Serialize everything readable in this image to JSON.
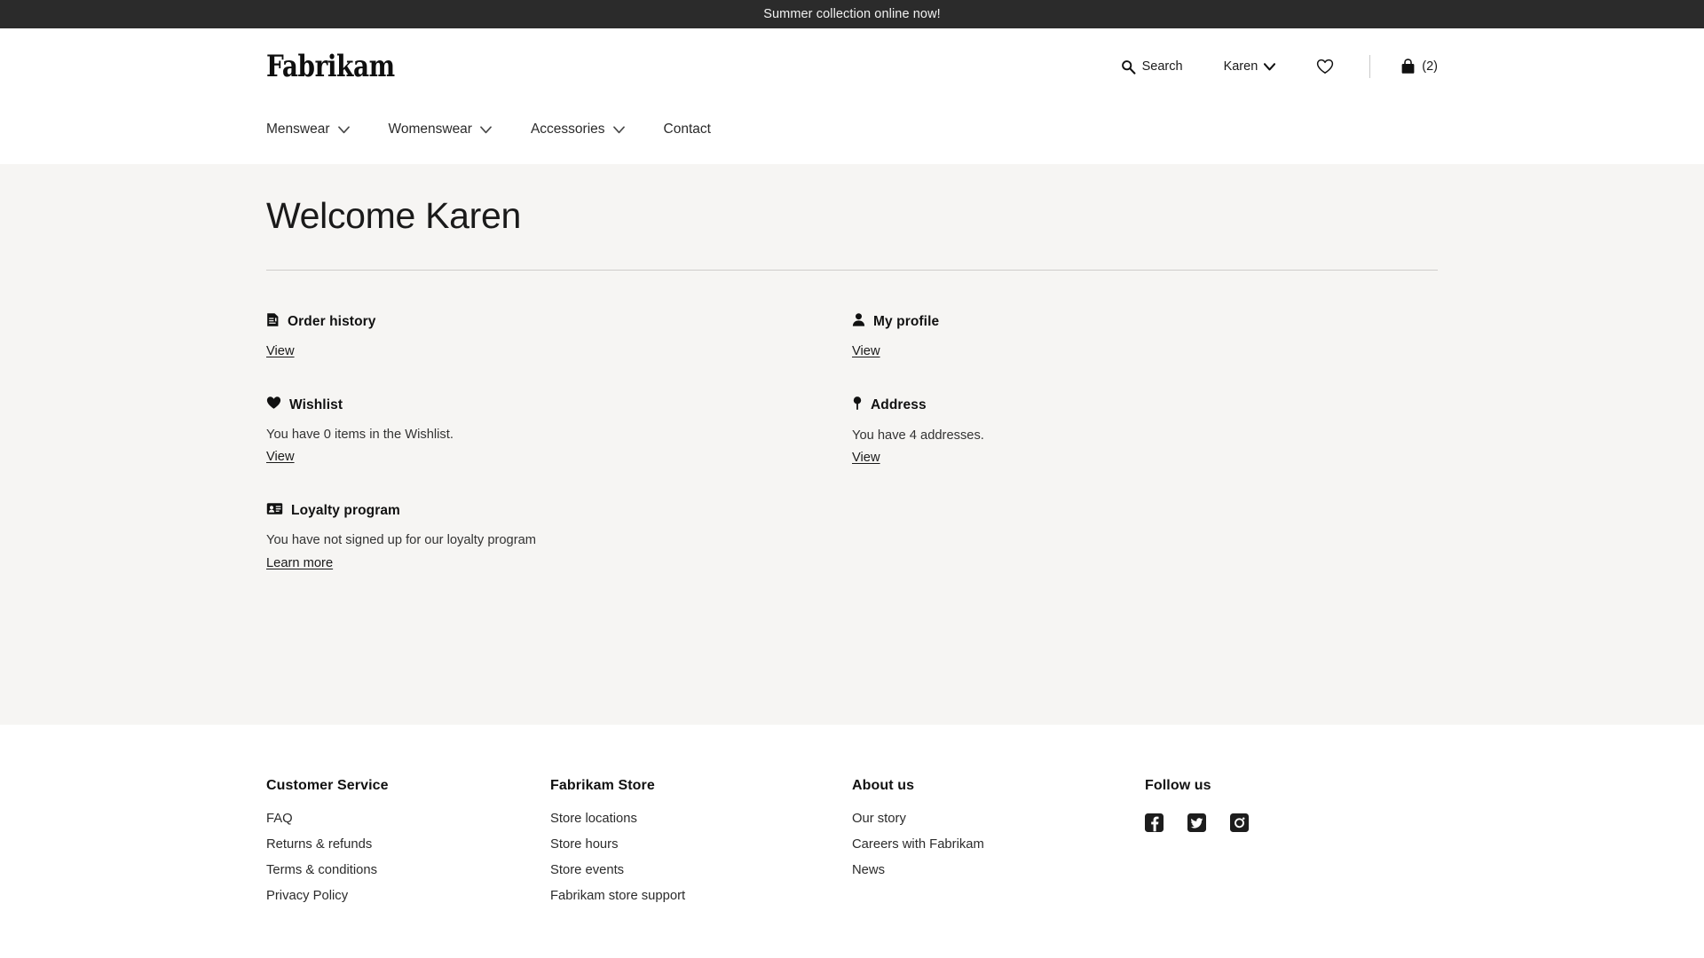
{
  "promo": {
    "text": "Summer collection online now!"
  },
  "header": {
    "logo": "Fabrikam",
    "search_label": "Search",
    "account_label": "Karen",
    "cart_count": "(2)",
    "icons": {
      "search": "search-icon",
      "account_chevron": "chevron-down-icon",
      "wishlist": "heart-outline-icon",
      "cart": "shopping-bag-icon"
    }
  },
  "nav": {
    "items": [
      {
        "label": "Menswear",
        "has_dropdown": true
      },
      {
        "label": "Womenswear",
        "has_dropdown": true
      },
      {
        "label": "Accessories",
        "has_dropdown": true
      },
      {
        "label": "Contact",
        "has_dropdown": false
      }
    ]
  },
  "account": {
    "page_title": "Welcome Karen",
    "cards": [
      {
        "key": "order-history",
        "icon": "receipt-icon",
        "title": "Order history",
        "description": "",
        "link": "View"
      },
      {
        "key": "my-profile",
        "icon": "person-icon",
        "title": "My profile",
        "description": "",
        "link": "View"
      },
      {
        "key": "wishlist",
        "icon": "heart-filled-icon",
        "title": "Wishlist",
        "description": "You have 0 items in the Wishlist.",
        "link": "View"
      },
      {
        "key": "address",
        "icon": "map-pin-icon",
        "title": "Address",
        "description": "You have 4 addresses.",
        "link": "View"
      },
      {
        "key": "loyalty-program",
        "icon": "id-card-icon",
        "title": "Loyalty program",
        "description": "You have not signed up for our loyalty program",
        "link": "Learn more"
      }
    ]
  },
  "footer": {
    "columns": [
      {
        "key": "customer-service",
        "heading": "Customer Service",
        "links": [
          "FAQ",
          "Returns & refunds",
          "Terms & conditions",
          "Privacy Policy"
        ]
      },
      {
        "key": "fabrikam-store",
        "heading": "Fabrikam Store",
        "links": [
          "Store locations",
          "Store hours",
          "Store events",
          "Fabrikam store support"
        ]
      },
      {
        "key": "about-us",
        "heading": "About us",
        "links": [
          "Our story",
          "Careers with Fabrikam",
          "News"
        ]
      }
    ],
    "follow": {
      "heading": "Follow us",
      "socials": [
        "facebook-icon",
        "twitter-icon",
        "instagram-icon"
      ]
    }
  },
  "colors": {
    "promo_bg": "#2b2b2b",
    "page_bg": "#ffffff",
    "account_bg": "#f6f5f3",
    "text": "#1a1a1a",
    "rule": "#cfcdca"
  }
}
